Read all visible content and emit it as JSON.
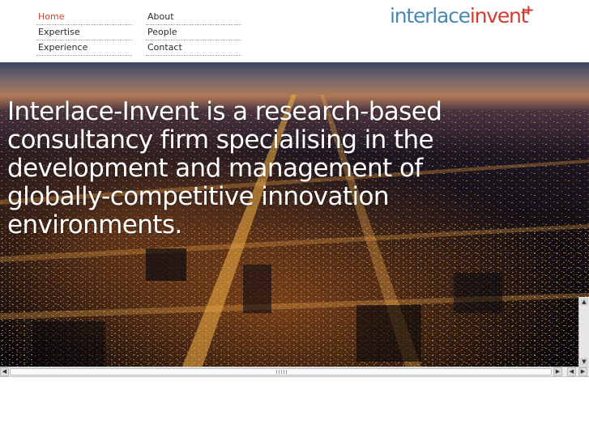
{
  "nav": {
    "left": [
      {
        "label": "Home",
        "active": true
      },
      {
        "label": "Expertise",
        "active": false
      },
      {
        "label": "Experience",
        "active": false
      }
    ],
    "right": [
      {
        "label": "About",
        "active": false
      },
      {
        "label": "People",
        "active": false
      },
      {
        "label": "Contact",
        "active": false
      }
    ]
  },
  "logo": {
    "part1": "interlace",
    "part2": "invent",
    "plus": "+",
    "colors": {
      "part1": "#4a88b4",
      "part2": "#d43a2f"
    }
  },
  "hero": {
    "text": "Interlace-Invent is a research-based consultancy firm specialising in the development and management of globally-competitive innovation environments.",
    "image": "night-city-aerial-photo"
  },
  "colors": {
    "active_nav": "#d9412b",
    "nav_text": "#2a2a2a"
  }
}
